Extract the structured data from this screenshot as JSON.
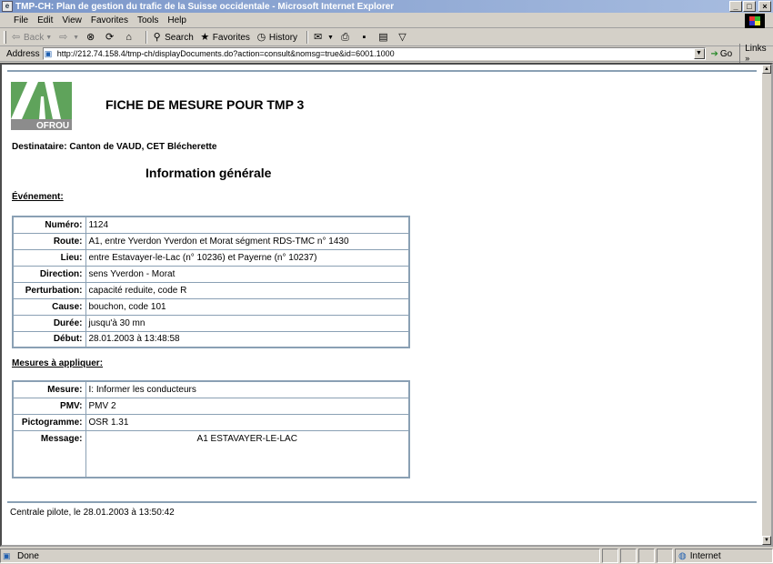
{
  "window": {
    "title": "TMP-CH: Plan de gestion du trafic de la Suisse occidentale - Microsoft Internet Explorer",
    "app_icon": "ie-icon",
    "controls": [
      "minimize",
      "maximize",
      "close"
    ]
  },
  "menu": {
    "items": [
      "File",
      "Edit",
      "View",
      "Favorites",
      "Tools",
      "Help"
    ]
  },
  "toolbar": {
    "back": "Back",
    "forward": "",
    "stop": "",
    "refresh": "",
    "home": "",
    "search": "Search",
    "favorites": "Favorites",
    "history": "History"
  },
  "address": {
    "label": "Address",
    "url": "http://212.74.158.4/tmp-ch/displayDocuments.do?action=consult&nomsg=true&id=6001.1000",
    "go": "Go",
    "links": "Links"
  },
  "page": {
    "logo_text": "OFROU",
    "title": "FICHE DE MESURE POUR TMP 3",
    "destinataire": "Destinataire: Canton de VAUD, CET Blécherette",
    "section_title": "Information générale",
    "event_heading": "Événement:",
    "event_rows": [
      {
        "k": "Numéro:",
        "v": "1124"
      },
      {
        "k": "Route:",
        "v": "A1, entre Yverdon Yverdon et Morat ségment RDS-TMC n° 1430"
      },
      {
        "k": "Lieu:",
        "v": "entre Estavayer-le-Lac (n° 10236) et Payerne (n° 10237)"
      },
      {
        "k": "Direction:",
        "v": "sens Yverdon - Morat"
      },
      {
        "k": "Perturbation:",
        "v": "capacité reduite, code R"
      },
      {
        "k": "Cause:",
        "v": "bouchon, code 101"
      },
      {
        "k": "Durée:",
        "v": "jusqu'à 30 mn"
      },
      {
        "k": "Début:",
        "v": "28.01.2003 à 13:48:58"
      }
    ],
    "measures_heading": "Mesures à appliquer:",
    "measure_rows": [
      {
        "k": "Mesure:",
        "v": "I: Informer les conducteurs"
      },
      {
        "k": "PMV:",
        "v": "PMV 2"
      },
      {
        "k": "Pictogramme:",
        "v": "OSR 1.31"
      }
    ],
    "message_label": "Message:",
    "message_value": "A1 ESTAVAYER-LE-LAC",
    "footer": "Centrale pilote, le 28.01.2003 à 13:50:42"
  },
  "status": {
    "text": "Done",
    "zone": "Internet"
  }
}
